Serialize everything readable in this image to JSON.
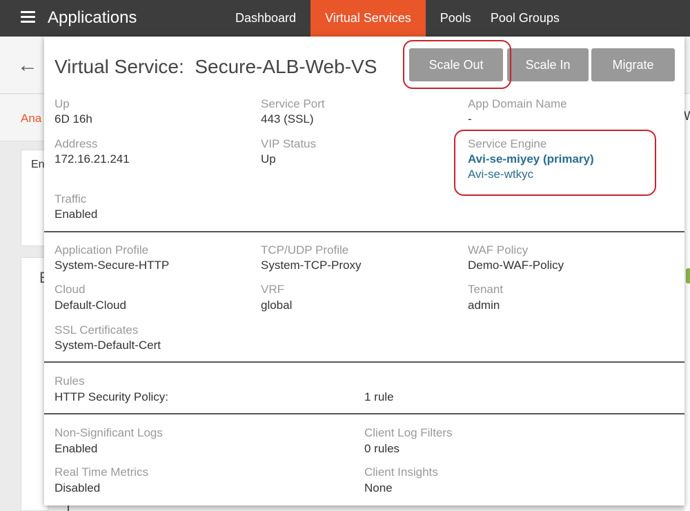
{
  "header": {
    "app_title": "Applications",
    "nav": [
      "Dashboard",
      "Virtual Services",
      "Pools",
      "Pool Groups"
    ],
    "active_nav": "Virtual Services"
  },
  "background": {
    "tab_text": "Ana",
    "card1_text": "En",
    "card2_text": "E",
    "right_edge_text": "W"
  },
  "panel": {
    "title": "Virtual Service:  Secure-ALB-Web-VS",
    "buttons": {
      "scale_out": "Scale Out",
      "scale_in": "Scale In",
      "migrate": "Migrate"
    },
    "summary": {
      "up": {
        "label": "Up",
        "value": "6D 16h"
      },
      "service_port": {
        "label": "Service Port",
        "value": "443 (SSL)"
      },
      "app_domain": {
        "label": "App Domain Name",
        "value": "-"
      },
      "address": {
        "label": "Address",
        "value": "172.16.21.241"
      },
      "vip_status": {
        "label": "VIP Status",
        "value": "Up"
      },
      "service_engine": {
        "label": "Service Engine",
        "primary": "Avi-se-miyey (primary)",
        "secondary": "Avi-se-wtkyc"
      },
      "traffic": {
        "label": "Traffic",
        "value": "Enabled"
      }
    },
    "profiles": {
      "app_profile": {
        "label": "Application Profile",
        "value": "System-Secure-HTTP"
      },
      "tcp_udp_profile": {
        "label": "TCP/UDP Profile",
        "value": "System-TCP-Proxy"
      },
      "waf_policy": {
        "label": "WAF Policy",
        "value": "Demo-WAF-Policy"
      },
      "cloud": {
        "label": "Cloud",
        "value": "Default-Cloud"
      },
      "vrf": {
        "label": "VRF",
        "value": "global"
      },
      "tenant": {
        "label": "Tenant",
        "value": "admin"
      },
      "ssl_certs": {
        "label": "SSL Certificates",
        "value": "System-Default-Cert"
      }
    },
    "rules": {
      "label": "Rules",
      "http_security_label": "HTTP Security Policy:",
      "http_security_value": "1 rule"
    },
    "logs": {
      "non_sig_logs": {
        "label": "Non-Significant Logs",
        "value": "Enabled"
      },
      "client_log_filters": {
        "label": "Client Log Filters",
        "value": "0 rules"
      },
      "real_time_metrics": {
        "label": "Real Time Metrics",
        "value": "Disabled"
      },
      "client_insights": {
        "label": "Client Insights",
        "value": "None"
      }
    }
  },
  "colors": {
    "nav_bg": "#3d3d3d",
    "nav_active": "#e8562a",
    "button_gray": "#999999",
    "highlight_red": "#c8232c",
    "link": "#2a6d8f"
  }
}
